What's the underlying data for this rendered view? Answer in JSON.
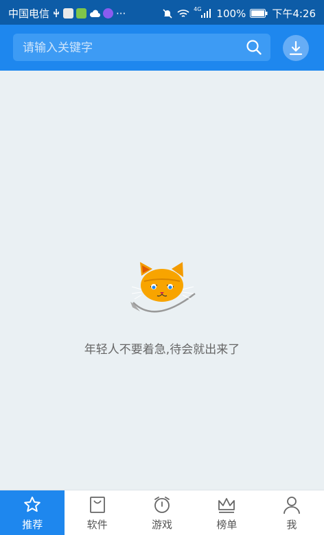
{
  "status_bar": {
    "carrier": "中国电信",
    "signal_type": "4G",
    "battery": "100%",
    "time": "下午4:26",
    "more": "···"
  },
  "header": {
    "search_placeholder": "请输入关键字",
    "accent_color": "#1e87ee"
  },
  "main": {
    "empty_message": "年轻人不要着急,待会就出来了",
    "illustration": "orange-cat"
  },
  "tabbar": {
    "active_color": "#1e87ee",
    "tabs": [
      {
        "label": "推荐",
        "icon": "star-icon",
        "active": true
      },
      {
        "label": "软件",
        "icon": "bag-icon",
        "active": false
      },
      {
        "label": "游戏",
        "icon": "alarm-clock-icon",
        "active": false
      },
      {
        "label": "榜单",
        "icon": "crown-icon",
        "active": false
      },
      {
        "label": "我",
        "icon": "user-icon",
        "active": false
      }
    ]
  }
}
